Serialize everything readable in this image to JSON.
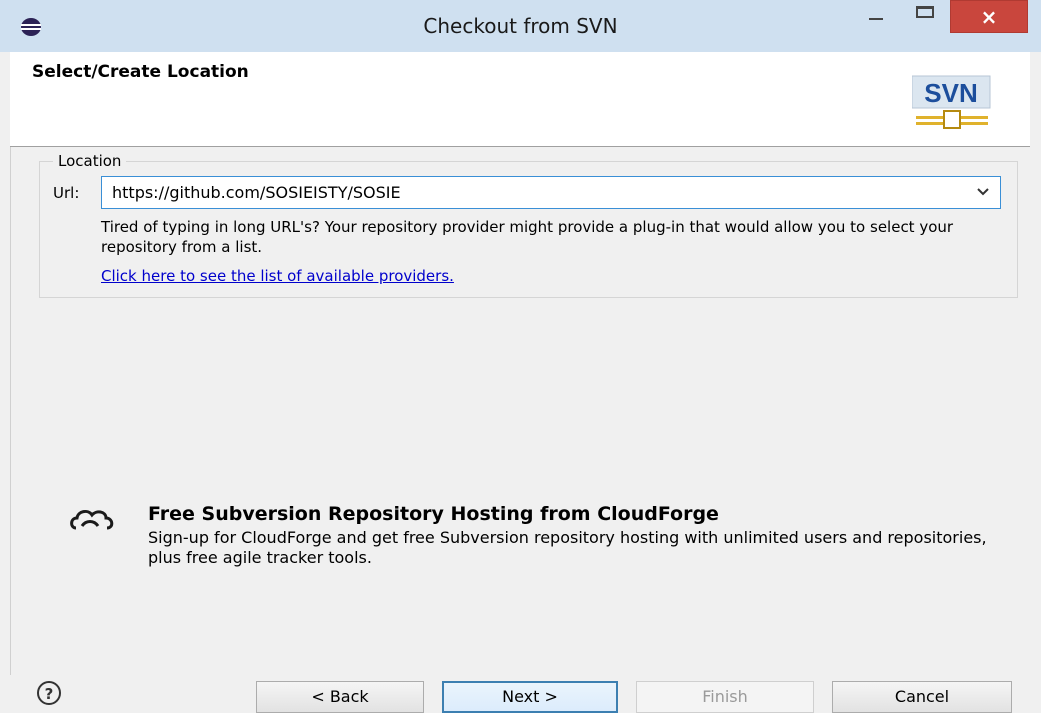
{
  "window": {
    "title": "Checkout from SVN",
    "close_glyph": "×"
  },
  "banner": {
    "title": "Select/Create Location",
    "logo_text": "SVN"
  },
  "location": {
    "group_label": "Location",
    "url_label": "Url:",
    "url_value": "https://github.com/SOSIEISTY/SOSIE",
    "hint": "Tired of typing in long URL's?  Your repository provider might provide a plug-in that would allow you to select your repository from a list.",
    "providers_link": "Click here to see the list of available providers."
  },
  "promo": {
    "title": "Free Subversion Repository Hosting from CloudForge",
    "body": "Sign-up for CloudForge and get free Subversion repository hosting with unlimited users and repositories, plus free agile tracker tools."
  },
  "buttons": {
    "help_glyph": "?",
    "back": "< Back",
    "next": "Next >",
    "finish": "Finish",
    "cancel": "Cancel"
  },
  "colors": {
    "titlebar": "#cfe0f0",
    "close": "#c9463d",
    "link": "#0000cc",
    "accent_border": "#3a8fd6"
  },
  "icons": [
    "eclipse-app-icon",
    "minimize-icon",
    "maximize-icon",
    "close-icon",
    "svn-logo-icon",
    "chevron-down-icon",
    "cloudforge-icon",
    "help-icon"
  ]
}
